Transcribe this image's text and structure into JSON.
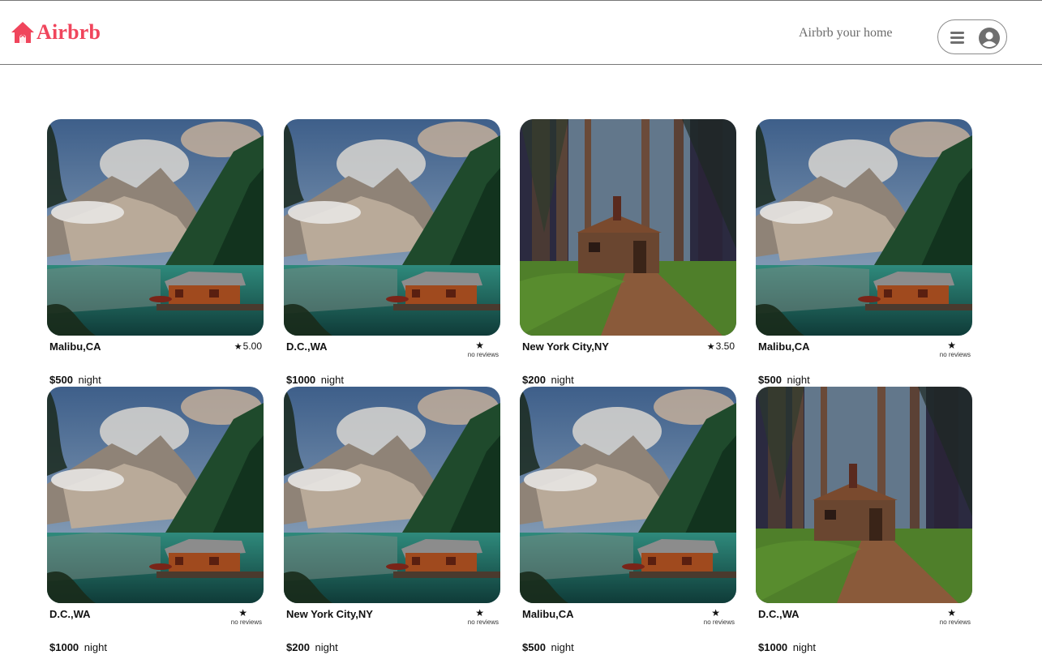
{
  "header": {
    "logo_text": "Airbrb",
    "host_link": "Airbrb your home",
    "brand_color": "#f0455c"
  },
  "listings": [
    {
      "location": "Malibu,CA",
      "rating": "5.00",
      "reviews_text": "",
      "price": "$500",
      "unit": "night",
      "image": "lake-cabin"
    },
    {
      "location": "D.C.,WA",
      "rating": "",
      "reviews_text": "no reviews",
      "price": "$1000",
      "unit": "night",
      "image": "lake-cabin"
    },
    {
      "location": "New York City,NY",
      "rating": "3.50",
      "reviews_text": "",
      "price": "$200",
      "unit": "night",
      "image": "forest-cabin"
    },
    {
      "location": "Malibu,CA",
      "rating": "",
      "reviews_text": "no reviews",
      "price": "$500",
      "unit": "night",
      "image": "lake-cabin"
    },
    {
      "location": "D.C.,WA",
      "rating": "",
      "reviews_text": "no reviews",
      "price": "$1000",
      "unit": "night",
      "image": "lake-cabin"
    },
    {
      "location": "New York City,NY",
      "rating": "",
      "reviews_text": "no reviews",
      "price": "$200",
      "unit": "night",
      "image": "lake-cabin"
    },
    {
      "location": "Malibu,CA",
      "rating": "",
      "reviews_text": "no reviews",
      "price": "$500",
      "unit": "night",
      "image": "lake-cabin"
    },
    {
      "location": "D.C.,WA",
      "rating": "",
      "reviews_text": "no reviews",
      "price": "$1000",
      "unit": "night",
      "image": "forest-cabin"
    }
  ]
}
